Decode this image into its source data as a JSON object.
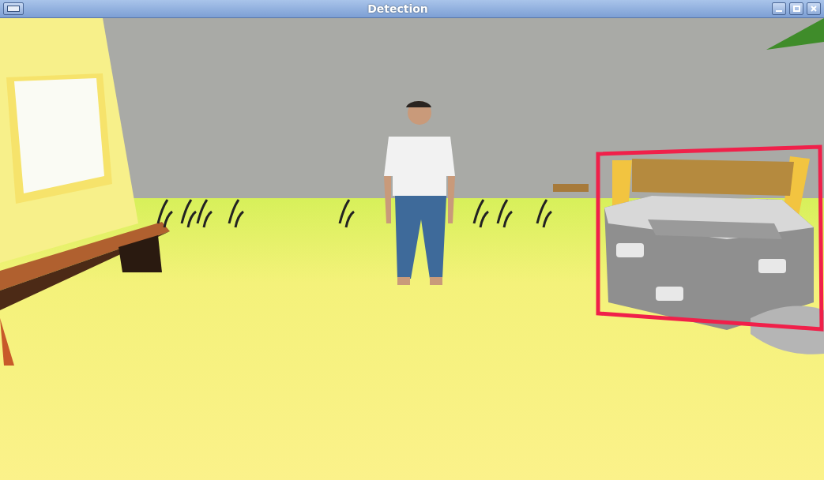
{
  "window": {
    "title": "Detection"
  }
}
